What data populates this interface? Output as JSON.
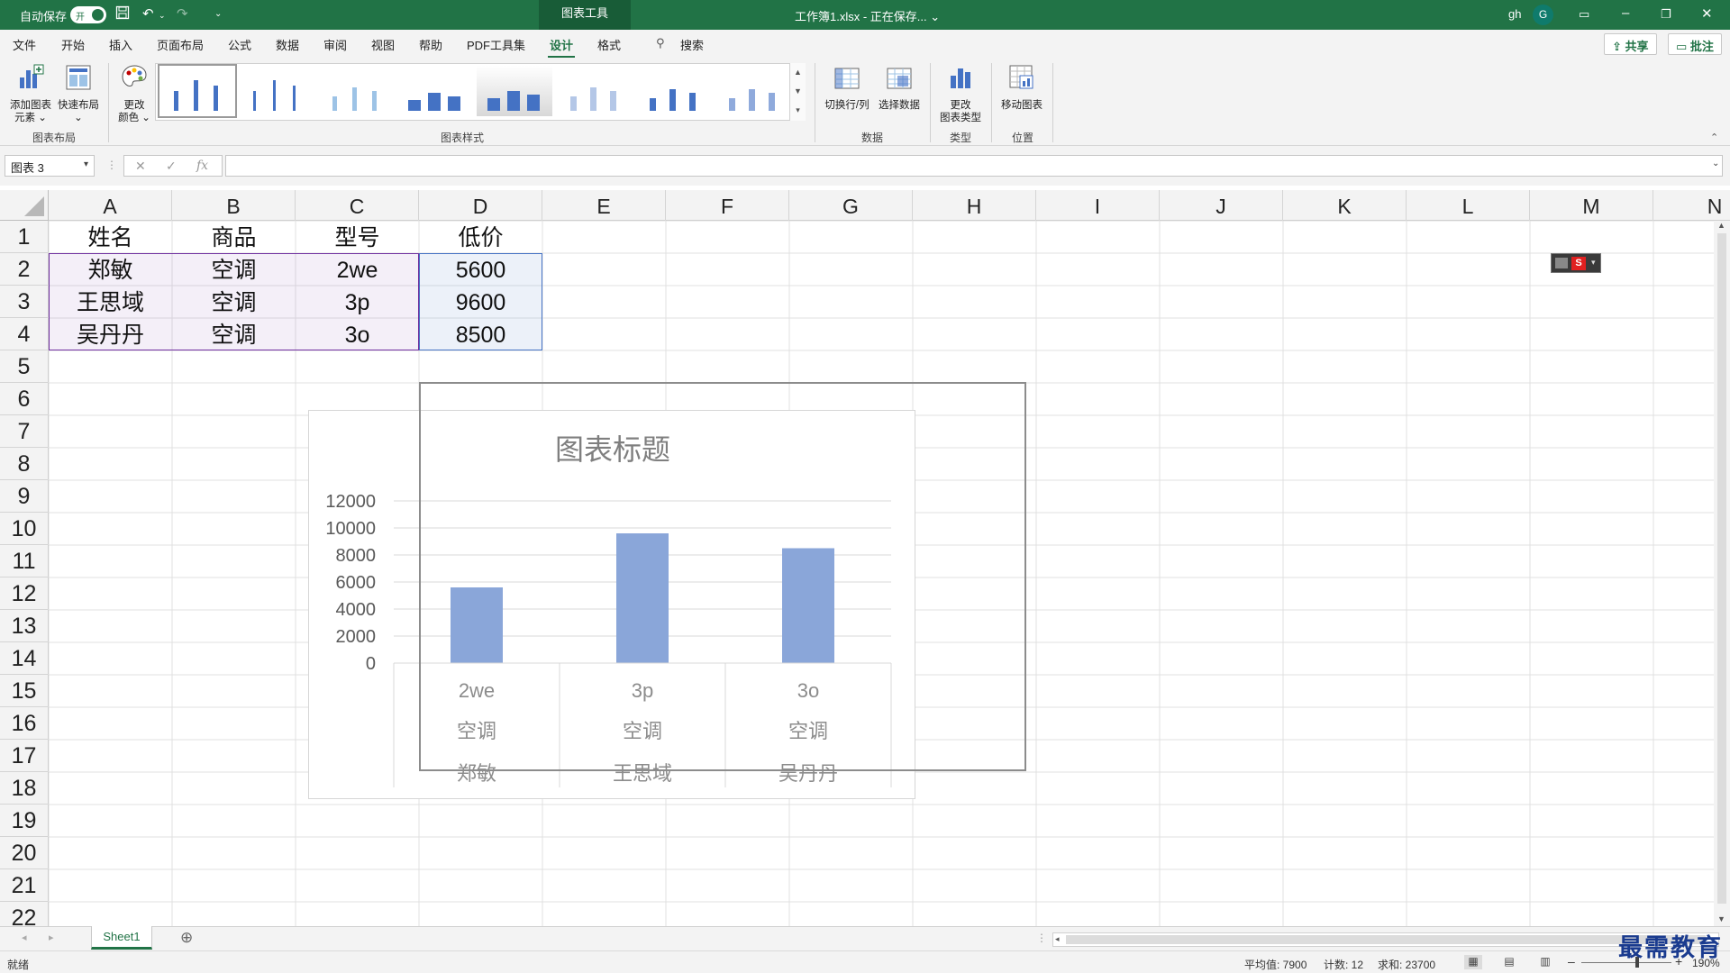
{
  "titlebar": {
    "autosave_label": "自动保存",
    "autosave_state": "开",
    "context_tab": "图表工具",
    "doc_title": "工作簿1.xlsx - 正在保存... ⌄",
    "user_name": "gh",
    "avatar_letter": "G"
  },
  "menu": {
    "items": [
      "文件",
      "开始",
      "插入",
      "页面布局",
      "公式",
      "数据",
      "审阅",
      "视图",
      "帮助",
      "PDF工具集",
      "设计",
      "格式"
    ],
    "active": "设计",
    "search_label": "搜索",
    "share_label": "共享",
    "comments_label": "批注"
  },
  "ribbon": {
    "add_element": "添加图表\n元素 ⌄",
    "quick_layout": "快速布局\n⌄",
    "change_colors": "更改\n颜色 ⌄",
    "switch_row_col": "切换行/列",
    "select_data": "选择数据",
    "change_type": "更改\n图表类型",
    "move_chart": "移动图表",
    "groups": {
      "layout": "图表布局",
      "styles": "图表样式",
      "data": "数据",
      "type": "类型",
      "location": "位置"
    }
  },
  "formula_bar": {
    "name_box": "图表 3",
    "cancel": "✕",
    "enter": "✓",
    "fx": "fx",
    "formula": ""
  },
  "grid": {
    "columns": [
      "A",
      "B",
      "C",
      "D",
      "E",
      "F",
      "G",
      "H",
      "I",
      "J",
      "K",
      "L",
      "M",
      "N"
    ],
    "rows": [
      "1",
      "2",
      "3",
      "4",
      "5",
      "6",
      "7",
      "8",
      "9",
      "10",
      "11",
      "12",
      "13",
      "14",
      "15",
      "16",
      "17",
      "18",
      "19",
      "20",
      "21",
      "22"
    ],
    "cells": [
      [
        "姓名",
        "商品",
        "型号",
        "低价"
      ],
      [
        "郑敏",
        "空调",
        "2we",
        "5600"
      ],
      [
        "王思域",
        "空调",
        "3p",
        "9600"
      ],
      [
        "吴丹丹",
        "空调",
        "3o",
        "8500"
      ]
    ]
  },
  "chart_data": {
    "type": "bar",
    "title": "图表标题",
    "categories": [
      [
        "2we",
        "空调",
        "郑敏"
      ],
      [
        "3p",
        "空调",
        "王思域"
      ],
      [
        "3o",
        "空调",
        "吴丹丹"
      ]
    ],
    "series": [
      {
        "values": [
          5600,
          9600,
          8500
        ]
      }
    ],
    "ylim": [
      0,
      12000
    ],
    "yticks": [
      "0",
      "2000",
      "4000",
      "6000",
      "8000",
      "10000",
      "12000"
    ],
    "grid": true,
    "bar_color": "#8aa6d9"
  },
  "sheets": {
    "tabs": [
      "Sheet1"
    ],
    "add": "⊕"
  },
  "status": {
    "ready": "就绪",
    "average": "平均值: 7900",
    "count": "计数: 12",
    "sum": "求和: 23700",
    "zoom": "190%"
  },
  "colors": {
    "brand": "#217346",
    "selection_purple": "#7030a0",
    "selection_blue": "#4472c4"
  },
  "watermark": "最需教育"
}
